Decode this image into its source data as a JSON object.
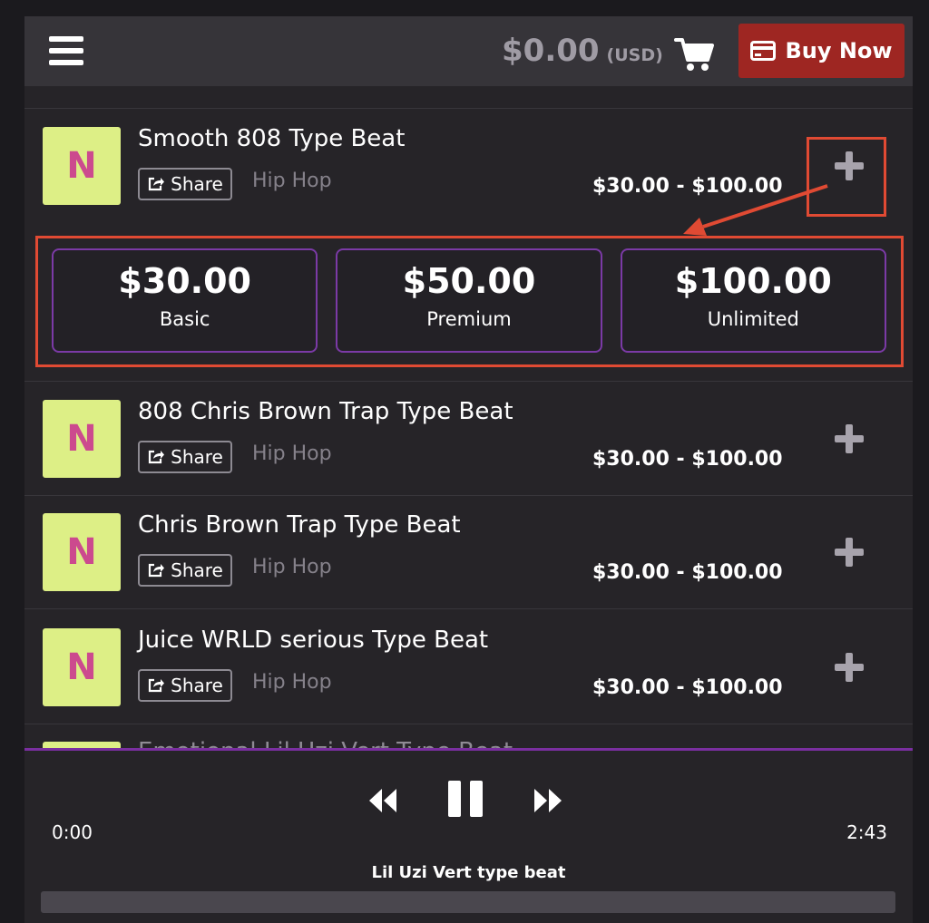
{
  "header": {
    "total_amount": "$0.00",
    "currency": "(USD)",
    "buy_now_label": "Buy Now"
  },
  "icons": {
    "menu": "hamburger-icon",
    "cart": "cart-icon",
    "buy_now": "credit-card-icon",
    "share": "share-icon",
    "add": "plus-icon",
    "rewind": "rewind-icon",
    "pause": "pause-icon",
    "fast_forward": "fast-forward-icon"
  },
  "colors": {
    "accent_purple": "#7a2fa0",
    "buy_now_red": "#9e2622",
    "thumbnail_bg": "#ddef86",
    "thumbnail_letter": "#cc4a8e",
    "annotation_red": "#e04a33"
  },
  "tracks": [
    {
      "thumb_letter": "N",
      "title": "Smooth 808 Type Beat",
      "share_label": "Share",
      "genre": "Hip Hop",
      "price_range": "$30.00 - $100.00"
    },
    {
      "thumb_letter": "N",
      "title": "808 Chris Brown Trap Type Beat",
      "share_label": "Share",
      "genre": "Hip Hop",
      "price_range": "$30.00 - $100.00"
    },
    {
      "thumb_letter": "N",
      "title": "Chris Brown Trap Type Beat",
      "share_label": "Share",
      "genre": "Hip Hop",
      "price_range": "$30.00 - $100.00"
    },
    {
      "thumb_letter": "N",
      "title": "Juice WRLD serious Type Beat",
      "share_label": "Share",
      "genre": "Hip Hop",
      "price_range": "$30.00 - $100.00"
    },
    {
      "thumb_letter": "",
      "title": "Emotional Lil Uzi Vert Type Beat"
    }
  ],
  "licenses": [
    {
      "price": "$30.00",
      "name": "Basic"
    },
    {
      "price": "$50.00",
      "name": "Premium"
    },
    {
      "price": "$100.00",
      "name": "Unlimited"
    }
  ],
  "player": {
    "current_time": "0:00",
    "total_time": "2:43",
    "now_playing": "Lil Uzi Vert type beat",
    "progress": 0
  }
}
